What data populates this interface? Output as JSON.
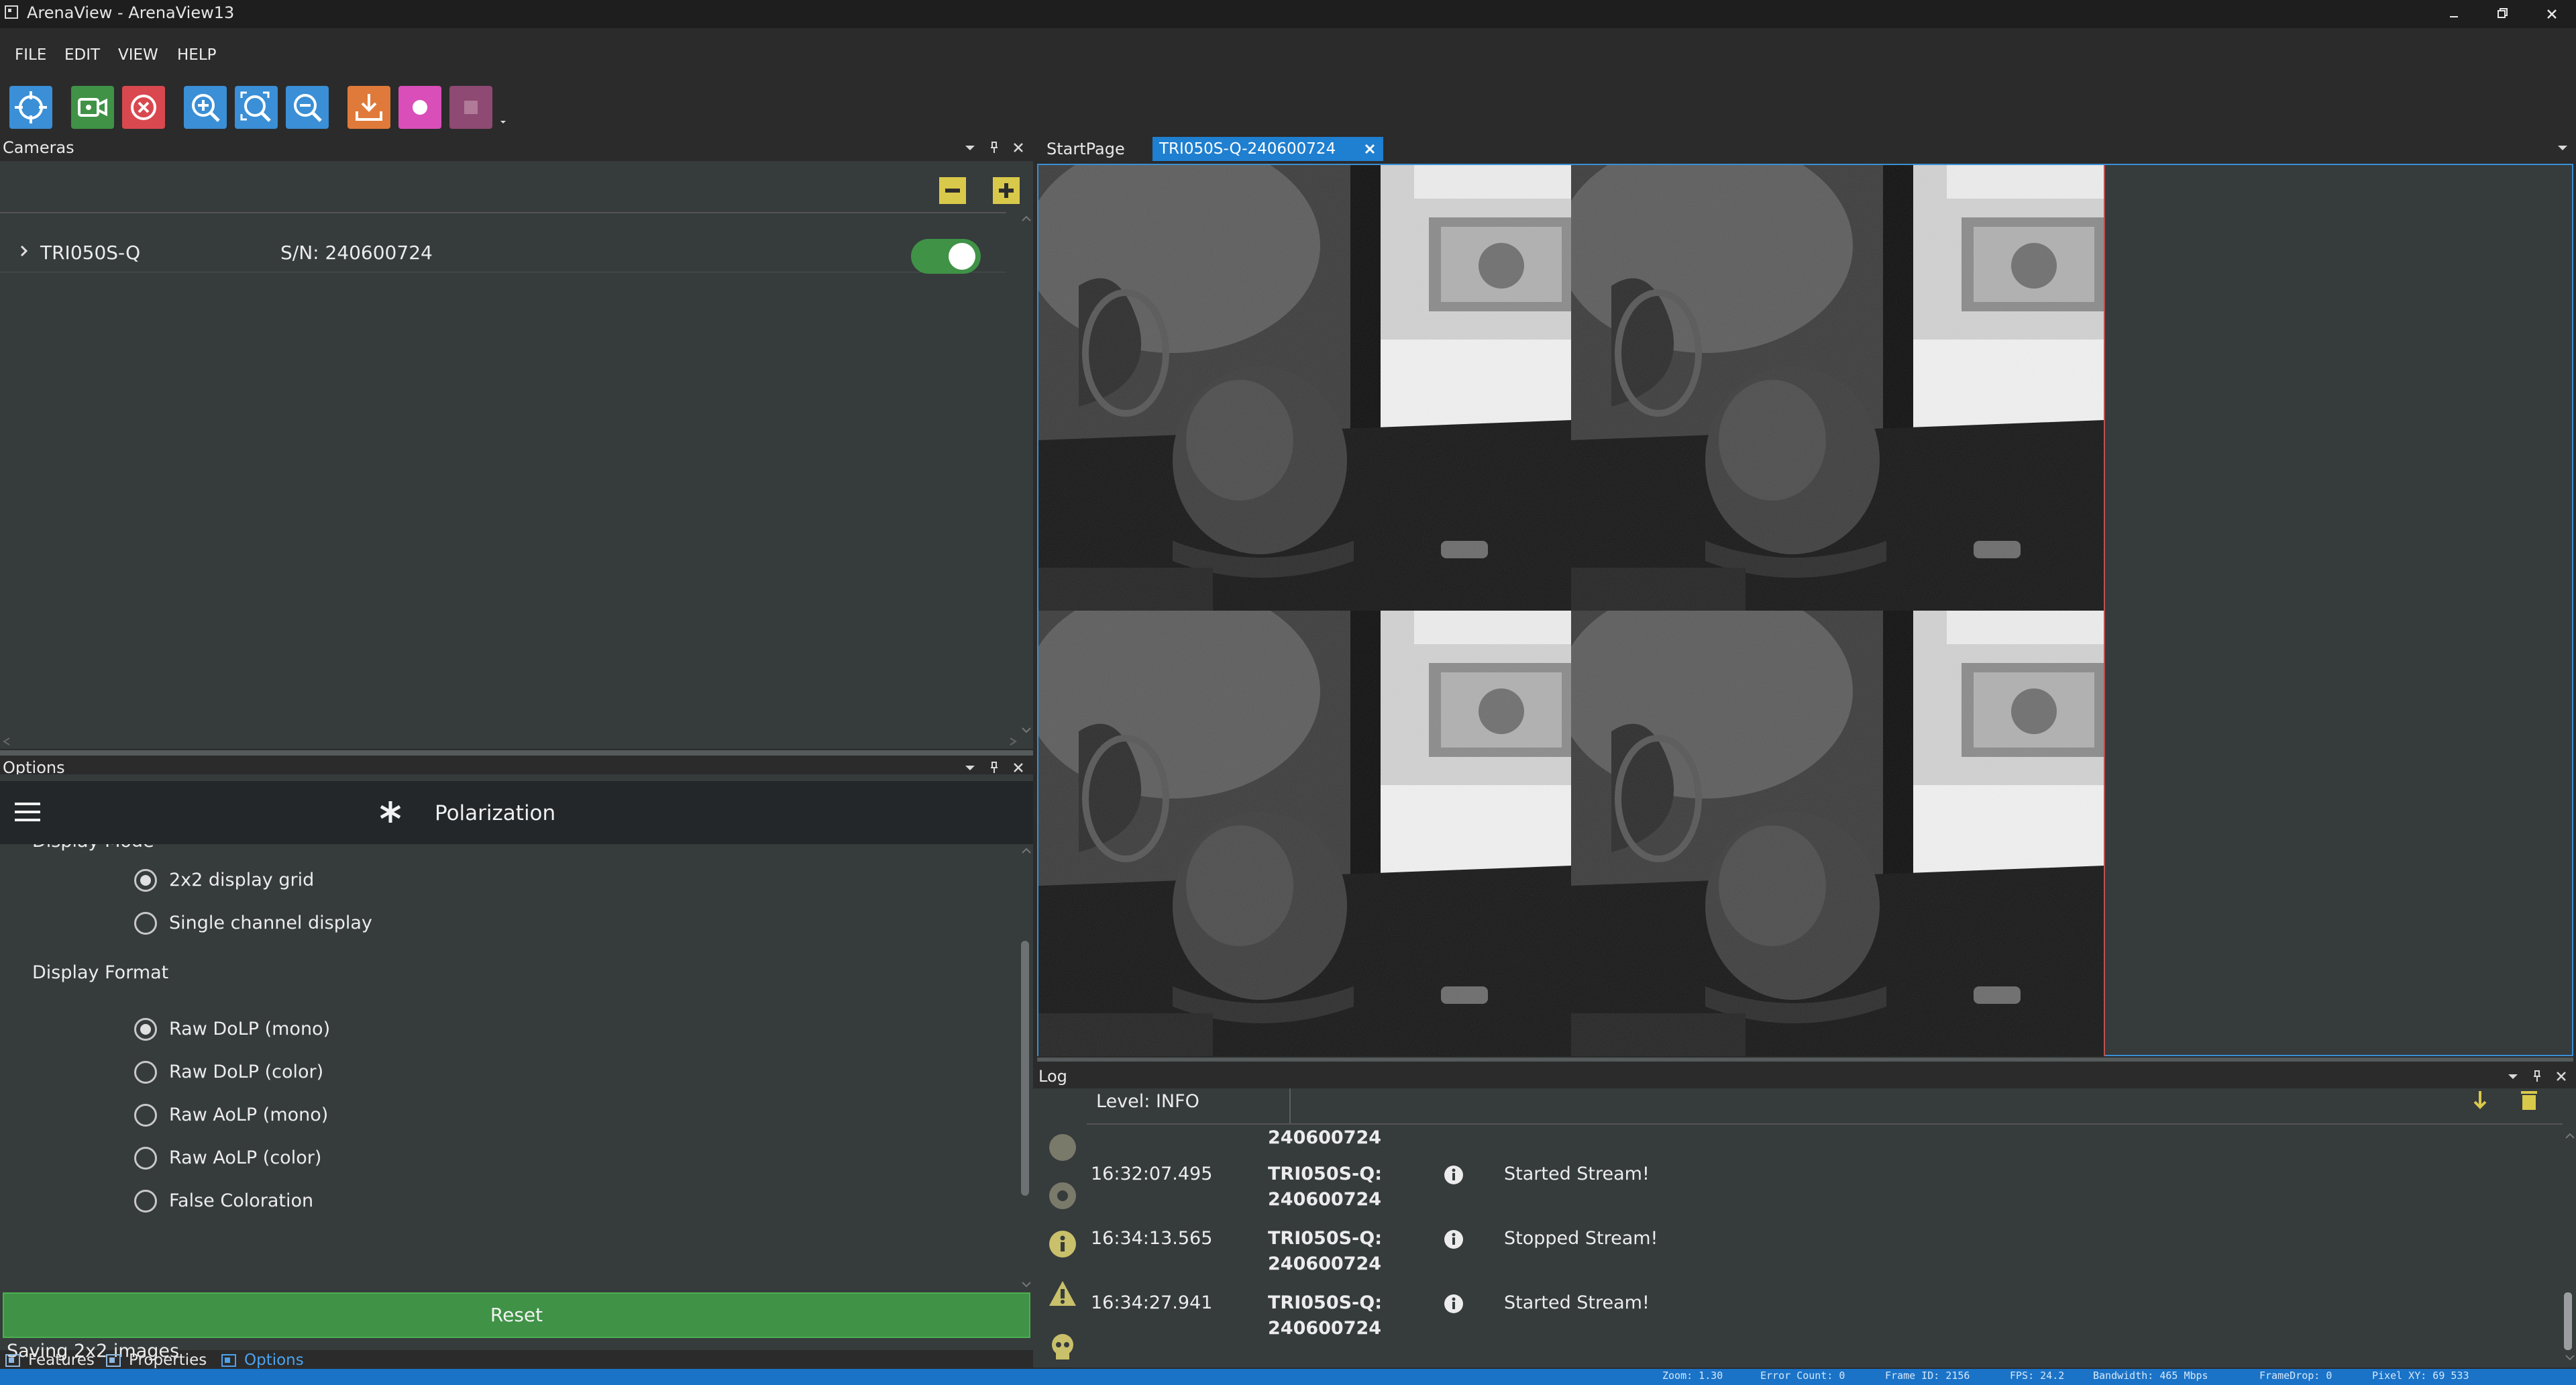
{
  "window": {
    "title": "ArenaView - ArenaView13",
    "controls": [
      "minimize",
      "restore",
      "close"
    ]
  },
  "menu": [
    "FILE",
    "EDIT",
    "VIEW",
    "HELP"
  ],
  "toolbar": {
    "buttons": [
      {
        "name": "crosshair-icon",
        "color": "#3a8fd6"
      },
      {
        "name": "video-camera-icon",
        "color": "#3f9246"
      },
      {
        "name": "stop-circle-icon",
        "color": "#d9484f"
      },
      {
        "name": "zoom-in-icon",
        "color": "#3a8fd6"
      },
      {
        "name": "zoom-fit-icon",
        "color": "#3a8fd6"
      },
      {
        "name": "zoom-out-icon",
        "color": "#3a8fd6"
      },
      {
        "name": "save-image-icon",
        "color": "#e07a3a"
      },
      {
        "name": "record-icon",
        "color": "#d94eb8"
      },
      {
        "name": "stop-record-icon",
        "color": "#8e4a72"
      }
    ]
  },
  "cameras_panel": {
    "title": "Cameras",
    "device": {
      "model": "TRI050S-Q",
      "serial": "S/N: 240600724",
      "enabled": true
    }
  },
  "options_panel": {
    "title": "Options",
    "header": "Polarization",
    "display_mode_partial": "Display Mode",
    "display_mode_options": [
      {
        "label": "2x2 display grid",
        "checked": true
      },
      {
        "label": "Single channel display",
        "checked": false
      }
    ],
    "display_format_heading": "Display Format",
    "display_format_options": [
      {
        "label": "Raw DoLP (mono)",
        "checked": true
      },
      {
        "label": "Raw DoLP (color)",
        "checked": false
      },
      {
        "label": "Raw AoLP (mono)",
        "checked": false
      },
      {
        "label": "Raw AoLP (color)",
        "checked": false
      },
      {
        "label": "False Coloration",
        "checked": false
      }
    ],
    "saving_heading": "Saving 2x2 images",
    "reset_label": "Reset"
  },
  "bottom_tabs": [
    {
      "label": "Features",
      "active": false
    },
    {
      "label": "Properties",
      "active": false
    },
    {
      "label": "Options",
      "active": true
    }
  ],
  "view_tabs": [
    {
      "label": "StartPage",
      "active": false
    },
    {
      "label": "TRI050S-Q-240600724",
      "active": true
    }
  ],
  "log_panel": {
    "title": "Log",
    "level": "Level: INFO",
    "entries": [
      {
        "time": "",
        "device": "240600724",
        "message": ""
      },
      {
        "time": "16:32:07.495",
        "device": "TRI050S-Q:",
        "device2": "240600724",
        "message": "Started Stream!"
      },
      {
        "time": "16:34:13.565",
        "device": "TRI050S-Q:",
        "device2": "240600724",
        "message": "Stopped Stream!"
      },
      {
        "time": "16:34:27.941",
        "device": "TRI050S-Q:",
        "device2": "240600724",
        "message": "Started Stream!"
      }
    ]
  },
  "status": {
    "zoom": "Zoom: 1.30",
    "error_count": "Error Count: 0",
    "frame_id": "Frame ID: 2156",
    "fps": "FPS: 24.2",
    "bandwidth": "Bandwidth: 465 Mbps",
    "frame_drop": "FrameDrop: 0",
    "pixel_xy": "Pixel XY: 69 533"
  }
}
